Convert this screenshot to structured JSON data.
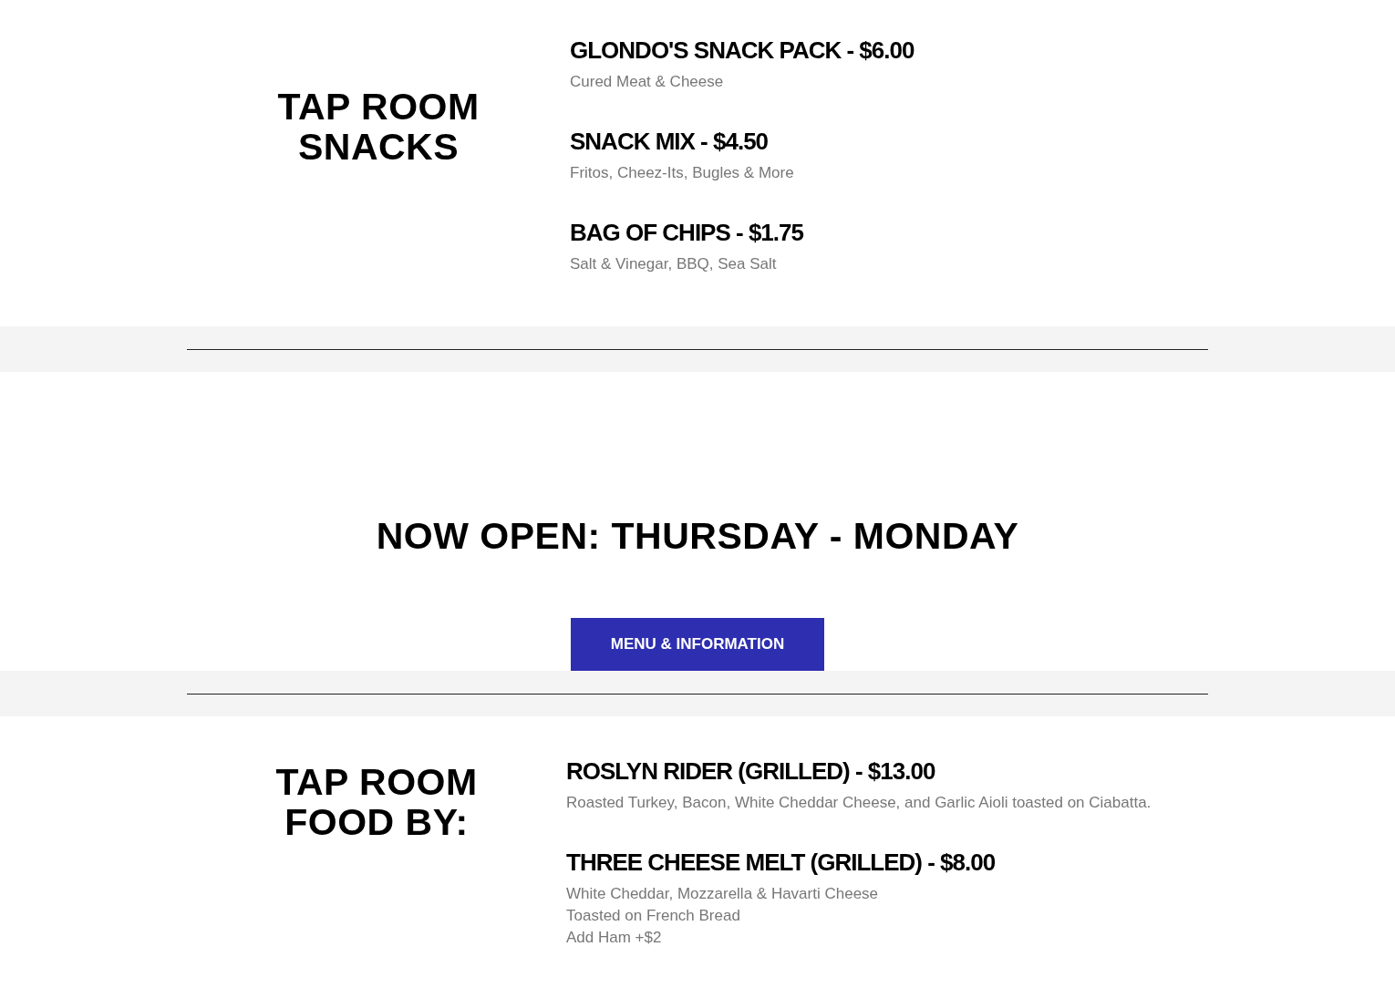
{
  "menu_sections": [
    {
      "heading": [
        "TAP ROOM",
        "SNACKS"
      ],
      "items": [
        {
          "title": "GLONDO'S SNACK PACK - $6.00",
          "description": [
            "Cured Meat & Cheese"
          ]
        },
        {
          "title": "SNACK MIX - $4.50",
          "description": [
            "Fritos, Cheez-Its, Bugles & More"
          ]
        },
        {
          "title": "BAG OF CHIPS - $1.75",
          "description": [
            "Salt & Vinegar, BBQ, Sea Salt"
          ]
        }
      ]
    }
  ],
  "hours": {
    "heading": "NOW OPEN: THURSDAY - MONDAY",
    "button": "MENU & INFORMATION"
  },
  "food_sections": [
    {
      "heading": [
        "TAP ROOM",
        "FOOD BY:"
      ],
      "items": [
        {
          "title": "ROSLYN RIDER (GRILLED) - $13.00",
          "description": [
            "Roasted Turkey, Bacon, White Cheddar Cheese, and Garlic Aioli toasted on Ciabatta."
          ]
        },
        {
          "title": "THREE CHEESE MELT (GRILLED) - $8.00",
          "description": [
            "White Cheddar, Mozzarella & Havarti Cheese",
            "Toasted on French Bread",
            "Add Ham +$2"
          ]
        }
      ]
    }
  ]
}
